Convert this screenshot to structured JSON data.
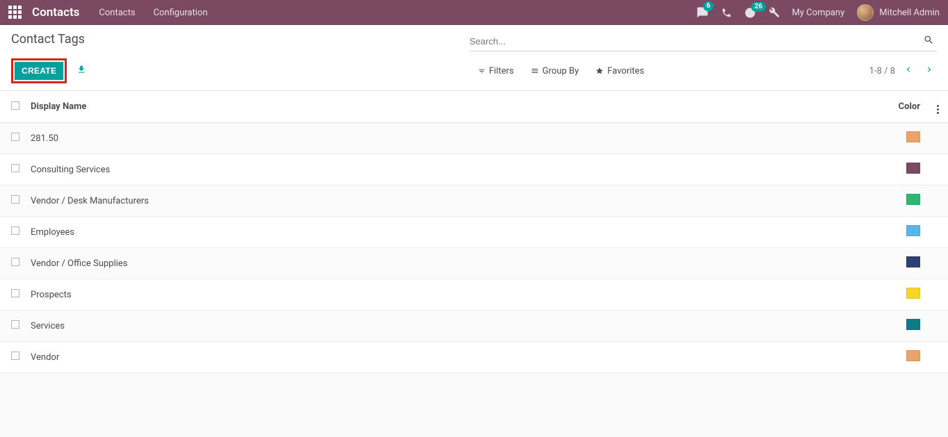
{
  "navbar": {
    "brand": "Contacts",
    "links": [
      "Contacts",
      "Configuration"
    ],
    "messages_badge": "6",
    "activities_badge": "26",
    "company": "My Company",
    "user": "Mitchell Admin"
  },
  "control_panel": {
    "title": "Contact Tags",
    "create_label": "CREATE",
    "search_placeholder": "Search...",
    "filters_label": "Filters",
    "groupby_label": "Group By",
    "favorites_label": "Favorites",
    "pager": "1-8 / 8"
  },
  "table": {
    "header_name": "Display Name",
    "header_color": "Color",
    "rows": [
      {
        "name": "281.50",
        "color": "#E9A36B"
      },
      {
        "name": "Consulting Services",
        "color": "#7C4962"
      },
      {
        "name": "Vendor / Desk Manufacturers",
        "color": "#2FB574"
      },
      {
        "name": "Employees",
        "color": "#58B6E8"
      },
      {
        "name": "Vendor / Office Supplies",
        "color": "#2E3F73"
      },
      {
        "name": "Prospects",
        "color": "#F5D728"
      },
      {
        "name": "Services",
        "color": "#0E7C86"
      },
      {
        "name": "Vendor",
        "color": "#E9A36B"
      }
    ]
  }
}
